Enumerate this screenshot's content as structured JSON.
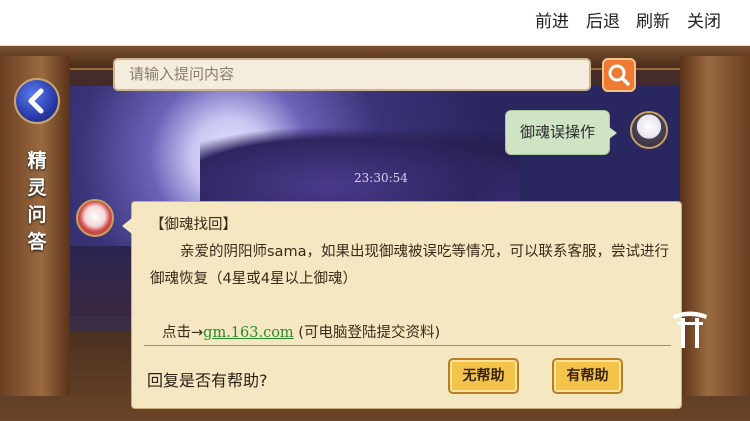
{
  "topbar": {
    "forward": "前进",
    "back": "后退",
    "refresh": "刷新",
    "close": "关闭"
  },
  "search": {
    "placeholder": "请输入提问内容",
    "button_icon": "search-icon"
  },
  "sidebar": {
    "back_icon": "chevron-left-icon",
    "title_chars": [
      "精",
      "灵",
      "问",
      "答"
    ]
  },
  "chat": {
    "timestamp": "23:30:54",
    "user_message": "御魂误操作",
    "answer": {
      "title": "【御魂找回】",
      "body": "亲爱的阴阳师sama，如果出现御魂被误吃等情况，可以联系客服，尝试进行御魂恢复（4星或4星以上御魂）",
      "link_prefix": "点击→",
      "link_text": "gm.163.com",
      "link_suffix": " (可电脑登陆提交资料)"
    },
    "feedback": {
      "question": "回复是否有帮助?",
      "not_helpful": "无帮助",
      "helpful": "有帮助"
    }
  },
  "colors": {
    "accent_orange": "#ef7a32",
    "card_bg": "#f6e7c3",
    "user_bubble": "#cfe3c5",
    "button_gold": "#f4c34a",
    "link_green": "#2a8a2a"
  }
}
